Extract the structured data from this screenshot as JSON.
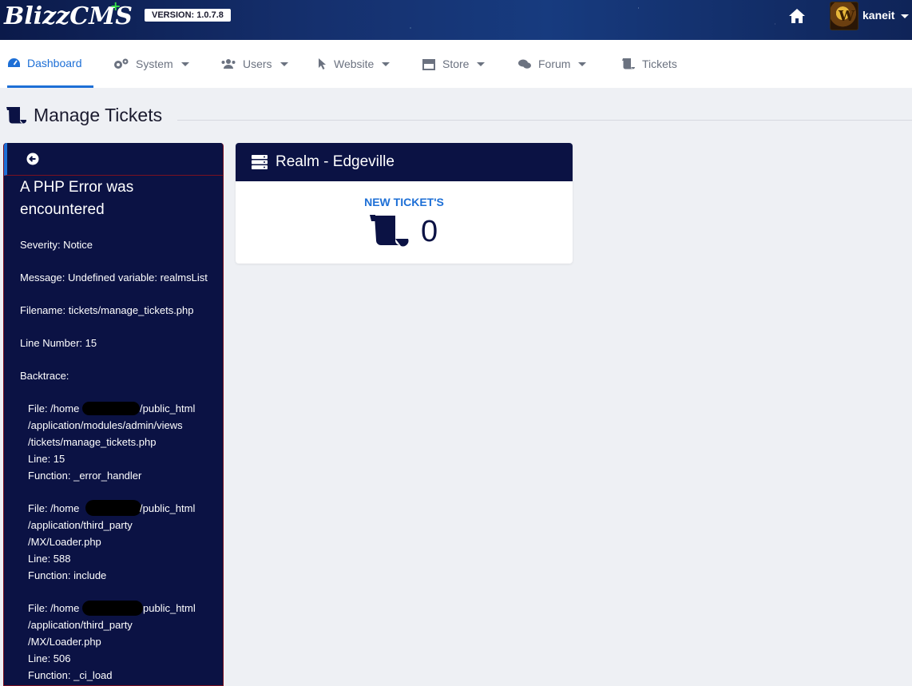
{
  "header": {
    "logo": "BlizzCMS",
    "logo_plus": "+",
    "version": "VERSION: 1.0.7.8",
    "username": "kaneit",
    "avatar_letter": "W"
  },
  "nav": {
    "items": [
      {
        "label": "Dashboard",
        "icon": "dashboard-icon",
        "active": true
      },
      {
        "label": "System",
        "icon": "gears-icon",
        "dropdown": true
      },
      {
        "label": "Users",
        "icon": "users-icon",
        "dropdown": true
      },
      {
        "label": "Website",
        "icon": "pointer-icon",
        "dropdown": true
      },
      {
        "label": "Store",
        "icon": "store-icon",
        "dropdown": true
      },
      {
        "label": "Forum",
        "icon": "comments-icon",
        "dropdown": true
      },
      {
        "label": "Tickets",
        "icon": "scroll-icon"
      }
    ]
  },
  "page": {
    "title": "Manage Tickets",
    "title_icon": "scroll-icon"
  },
  "error": {
    "title": "A PHP Error was encountered",
    "severity": "Severity: Notice",
    "message": "Message: Undefined variable: realmsList",
    "filename": "Filename: tickets/manage_tickets.php",
    "line_number": "Line Number: 15",
    "backtrace": "Backtrace:",
    "traces": [
      {
        "file_a": "File: /home",
        "file_b": "/public_html",
        "file_c": "/application/modules/admin/views",
        "file_d": "/tickets/manage_tickets.php",
        "line": "Line: 15",
        "function": "Function: _error_handler"
      },
      {
        "file_a": "File: /home",
        "file_b": "/public_html",
        "file_c": "/application/third_party",
        "file_d": "/MX/Loader.php",
        "line": "Line: 588",
        "function": "Function: include"
      },
      {
        "file_a": "File: /home",
        "file_b": "public_html",
        "file_c": "/application/third_party",
        "file_d": "/MX/Loader.php",
        "line": "Line: 506",
        "function": "Function: _ci_load"
      }
    ]
  },
  "realm": {
    "title": "Realm - Edgeville",
    "new_label": "NEW TICKET'S",
    "count": "0"
  },
  "colors": {
    "navy": "#0b1244",
    "accent": "#1d6fd6",
    "error_border": "#7a1020"
  }
}
